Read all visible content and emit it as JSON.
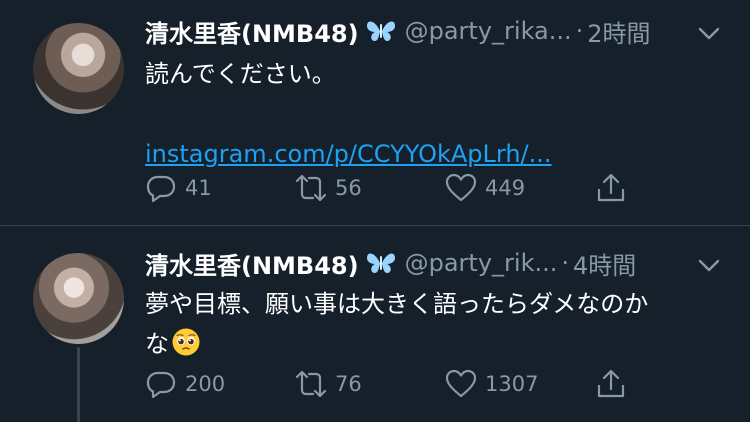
{
  "tweets": [
    {
      "display_name": "清水里香(NMB48)",
      "handle": "@party_rika...",
      "dot": "·",
      "time": "2時間",
      "text": "読んでください。",
      "link": "instagram.com/p/CCYYOkApLrh/...",
      "replies": "41",
      "retweets": "56",
      "likes": "449"
    },
    {
      "display_name": "清水里香(NMB48)",
      "handle": "@party_rik...",
      "dot": "·",
      "time": "4時間",
      "text_line1": "夢や目標、願い事は大きく語ったらダメなのか",
      "text_line2": "な",
      "replies": "200",
      "retweets": "76",
      "likes": "1307"
    }
  ],
  "icons": {
    "verified": "butterfly-icon",
    "menu": "chevron-down-icon",
    "reply": "reply-icon",
    "retweet": "retweet-icon",
    "like": "heart-icon",
    "share": "share-icon",
    "emoji": "pleading-face-emoji"
  },
  "colors": {
    "background": "#15202b",
    "secondary_text": "#8899a6",
    "link": "#1da1f2",
    "butterfly": "#9bd3ff"
  }
}
